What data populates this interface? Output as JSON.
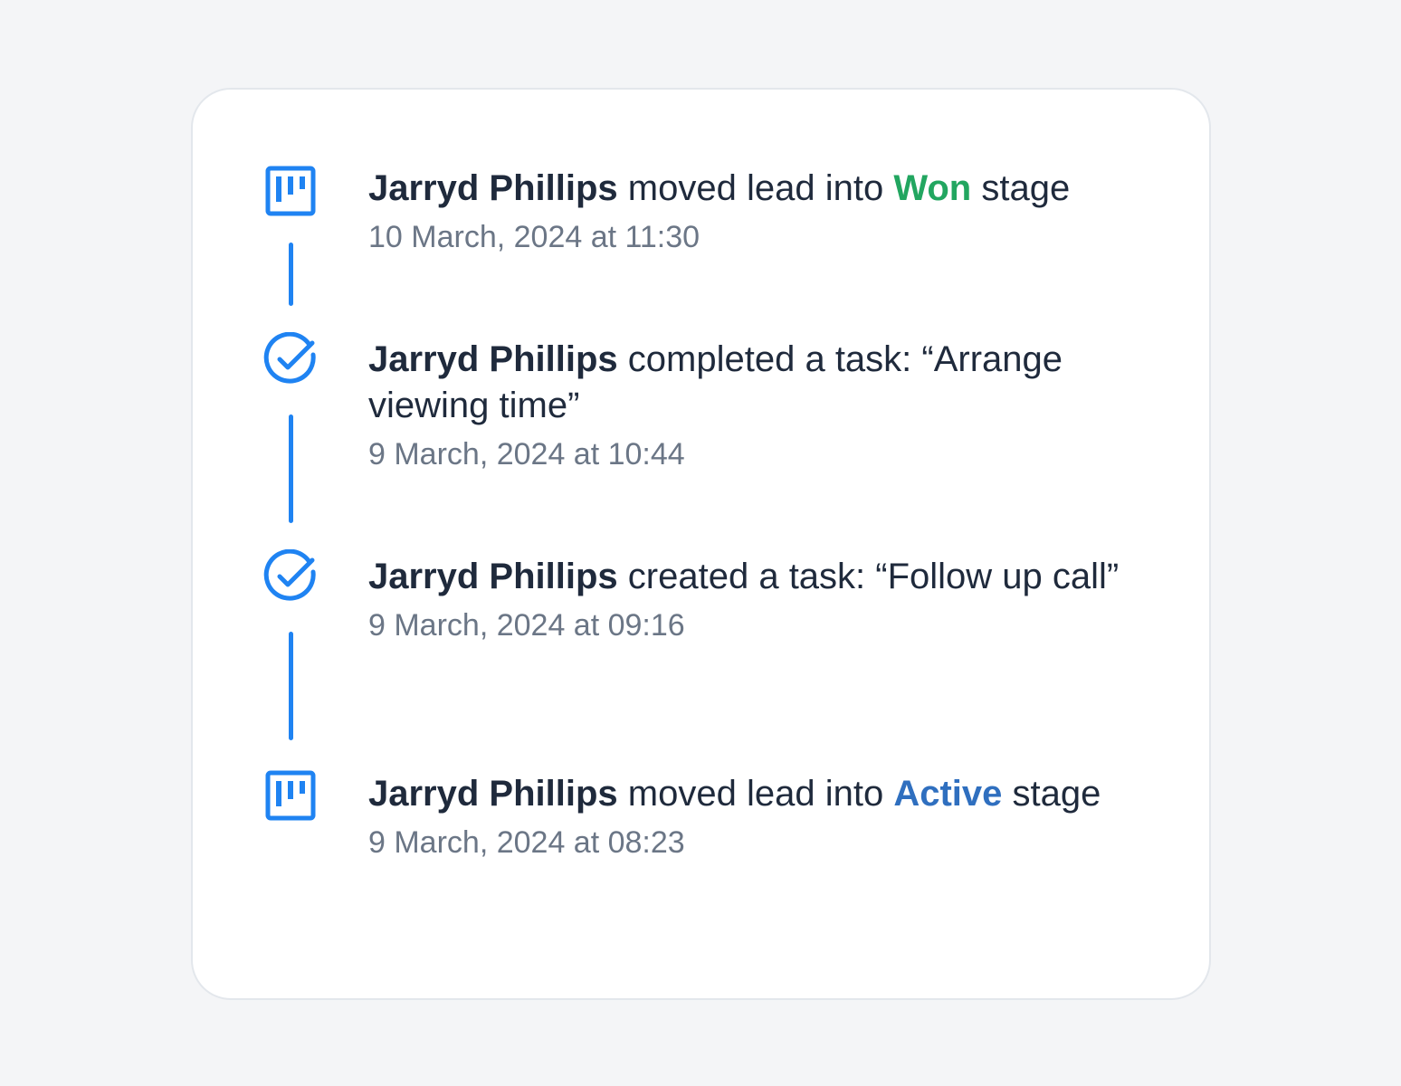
{
  "colors": {
    "page_background": "#f4f5f7",
    "card_background": "#ffffff",
    "accent_blue": "#1f83f2",
    "won_green": "#22a660",
    "active_blue": "#2f6fbf",
    "text_primary": "#1f2a3c",
    "text_secondary": "#6b7686"
  },
  "activity": [
    {
      "icon": "kanban-board-icon",
      "actor": "Jarryd Phillips",
      "action": "moved lead into",
      "stage": "Won",
      "suffix": "stage",
      "timestamp": "10 March, 2024 at 11:30"
    },
    {
      "icon": "check-circle-icon",
      "actor": "Jarryd Phillips",
      "action": "completed a task: “Arrange viewing time”",
      "timestamp": "9 March, 2024 at 10:44"
    },
    {
      "icon": "check-circle-icon",
      "actor": "Jarryd Phillips",
      "action": "created a task: “Follow up call”",
      "timestamp": "9 March, 2024 at 09:16"
    },
    {
      "icon": "kanban-board-icon",
      "actor": "Jarryd Phillips",
      "action": "moved lead into",
      "stage": "Active",
      "suffix": "stage",
      "timestamp": "9 March, 2024 at 08:23"
    }
  ]
}
